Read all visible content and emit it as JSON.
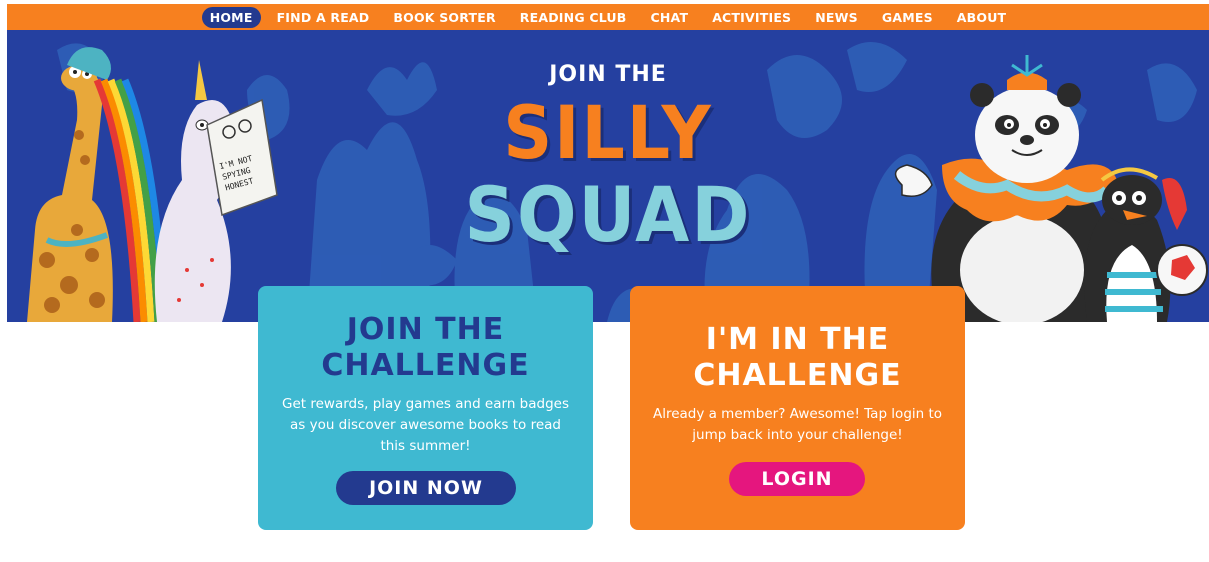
{
  "nav": {
    "items": [
      "HOME",
      "FIND A READ",
      "BOOK SORTER",
      "READING CLUB",
      "CHAT",
      "ACTIVITIES",
      "NEWS",
      "GAMES",
      "ABOUT"
    ],
    "active": "HOME"
  },
  "hero": {
    "join_text": "JOIN THE",
    "logo_line1": "SILLY",
    "logo_line2": "SQUAD",
    "newspaper_text": "I'M NOT SPYING HONEST"
  },
  "cards": {
    "join": {
      "title_line1": "JOIN THE",
      "title_line2": "CHALLENGE",
      "text": "Get rewards, play games and earn badges as you discover awesome books to read this summer!",
      "button": "JOIN NOW"
    },
    "member": {
      "title_line1": "I'M IN THE",
      "title_line2": "CHALLENGE",
      "text": "Already a member? Awesome! Tap login to jump back into your challenge!",
      "button": "LOGIN"
    }
  },
  "colors": {
    "nav_orange": "#f7801f",
    "hero_blue": "#2540a0",
    "card_blue": "#3fb9d1",
    "navy": "#233a8f",
    "pink": "#e5167e"
  }
}
